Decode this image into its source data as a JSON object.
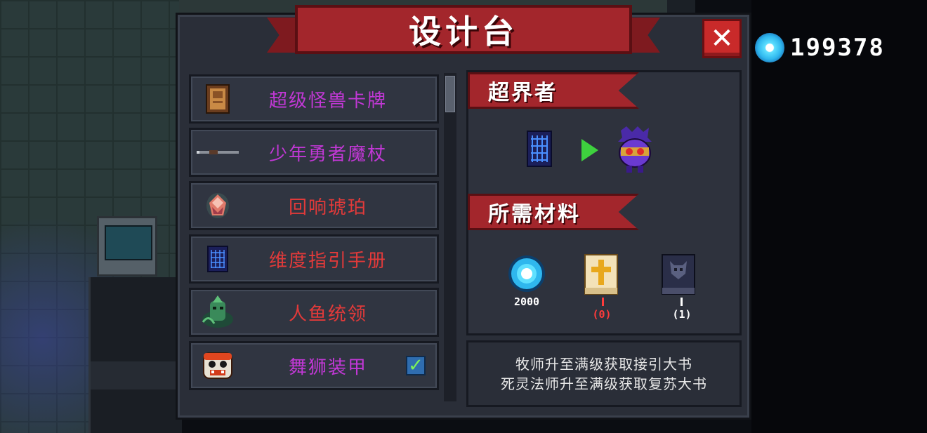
{
  "title": "设计台",
  "close_label": "✕",
  "currency": {
    "icon": "gem-icon",
    "amount": "199378",
    "color": "#2fb7ee"
  },
  "recipes": [
    {
      "label": "超级怪兽卡牌",
      "icon": "monster-card-icon",
      "color": "magenta"
    },
    {
      "label": "少年勇者魔杖",
      "icon": "wand-icon",
      "color": "magenta"
    },
    {
      "label": "回响琥珀",
      "icon": "amber-icon",
      "color": "red"
    },
    {
      "label": "维度指引手册",
      "icon": "dimension-manual-icon",
      "color": "red"
    },
    {
      "label": "人鱼统领",
      "icon": "merfolk-leader-icon",
      "color": "red"
    },
    {
      "label": "舞狮装甲",
      "icon": "lion-dance-armor-icon",
      "color": "magenta",
      "checked": true
    }
  ],
  "detail": {
    "result_title": "超界者",
    "materials_title": "所需材料",
    "materials": [
      {
        "icon": "gem-icon",
        "amount": "2000"
      },
      {
        "icon": "holy-book-icon",
        "amount": "(0)",
        "status": "insufficient"
      },
      {
        "icon": "dark-book-icon",
        "amount": "(1)"
      }
    ],
    "hint_lines": [
      "牧师升至满级获取接引大书",
      "死灵法师升至满级获取复苏大书"
    ]
  },
  "colors": {
    "accent_red": "#a3262c",
    "magenta_text": "#c238d6",
    "red_text": "#e23a3a",
    "insufficient": "#ff3b3b"
  }
}
